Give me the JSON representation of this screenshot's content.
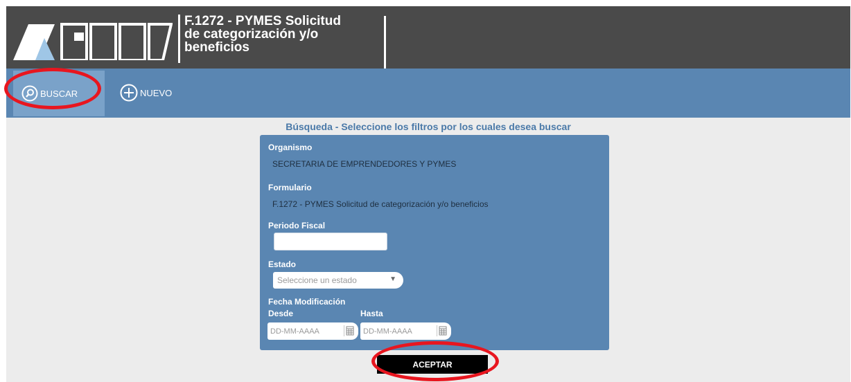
{
  "header": {
    "title": "F.1272 - PYMES Solicitud de categorización y/o beneficios",
    "title_lines": [
      "F.1272 - PYMES Solicitud",
      "de categorización y/o",
      "beneficios"
    ],
    "logo_icon": "afip-logo"
  },
  "toolbar": {
    "buttons": [
      {
        "label": "BUSCAR",
        "icon": "search-icon",
        "active": true
      },
      {
        "label": "NUEVO",
        "icon": "plus-circle-icon",
        "active": false
      }
    ]
  },
  "search": {
    "title": "Búsqueda - Seleccione los filtros por los cuales desea buscar",
    "organismo_label": "Organismo",
    "organismo_value": "SECRETARIA DE EMPRENDEDORES Y PYMES",
    "formulario_label": "Formulario",
    "formulario_value": "F.1272 - PYMES Solicitud de categorización y/o beneficios",
    "periodo_label": "Periodo Fiscal",
    "periodo_value": "",
    "estado_label": "Estado",
    "estado_placeholder": "Seleccione un estado",
    "fecha_label": "Fecha Modificación",
    "desde_label": "Desde",
    "hasta_label": "Hasta",
    "desde_placeholder": "DD-MM-AAAA",
    "hasta_placeholder": "DD-MM-AAAA"
  },
  "actions": {
    "accept_label": "ACEPTAR"
  },
  "colors": {
    "header_bg": "#4a4a4a",
    "toolbar_bg": "#5a86b2",
    "panel_bg": "#5a86b2",
    "title_text": "#4a79a8",
    "highlight_ring": "#e8161f",
    "accept_bg": "#000000"
  }
}
